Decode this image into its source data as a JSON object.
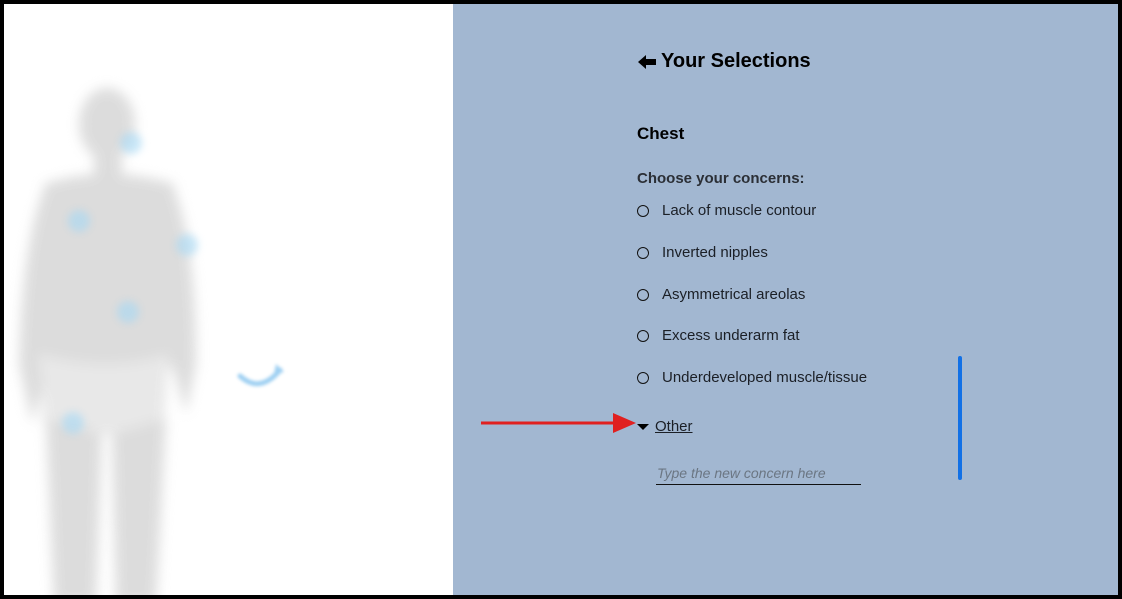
{
  "selections": {
    "title": "Your Selections",
    "section": "Chest",
    "concerns_label": "Choose your concerns:",
    "options": [
      {
        "label": "Lack of muscle contour",
        "selected": false
      },
      {
        "label": "Inverted nipples",
        "selected": false
      },
      {
        "label": "Asymmetrical areolas",
        "selected": false
      },
      {
        "label": "Excess underarm fat",
        "selected": false
      },
      {
        "label": "Underdeveloped muscle/tissue",
        "selected": false
      }
    ],
    "other": {
      "label": "Other",
      "expanded": true,
      "input_placeholder": "Type the new concern here",
      "input_value": ""
    }
  },
  "colors": {
    "panel_background": "#a2b7d1",
    "scrollbar": "#1170e6",
    "annotation_arrow": "#e02020"
  },
  "icons": {
    "back": "back-arrow-icon",
    "other_toggle": "caret-down-icon",
    "annotation": "red-pointer-arrow"
  }
}
